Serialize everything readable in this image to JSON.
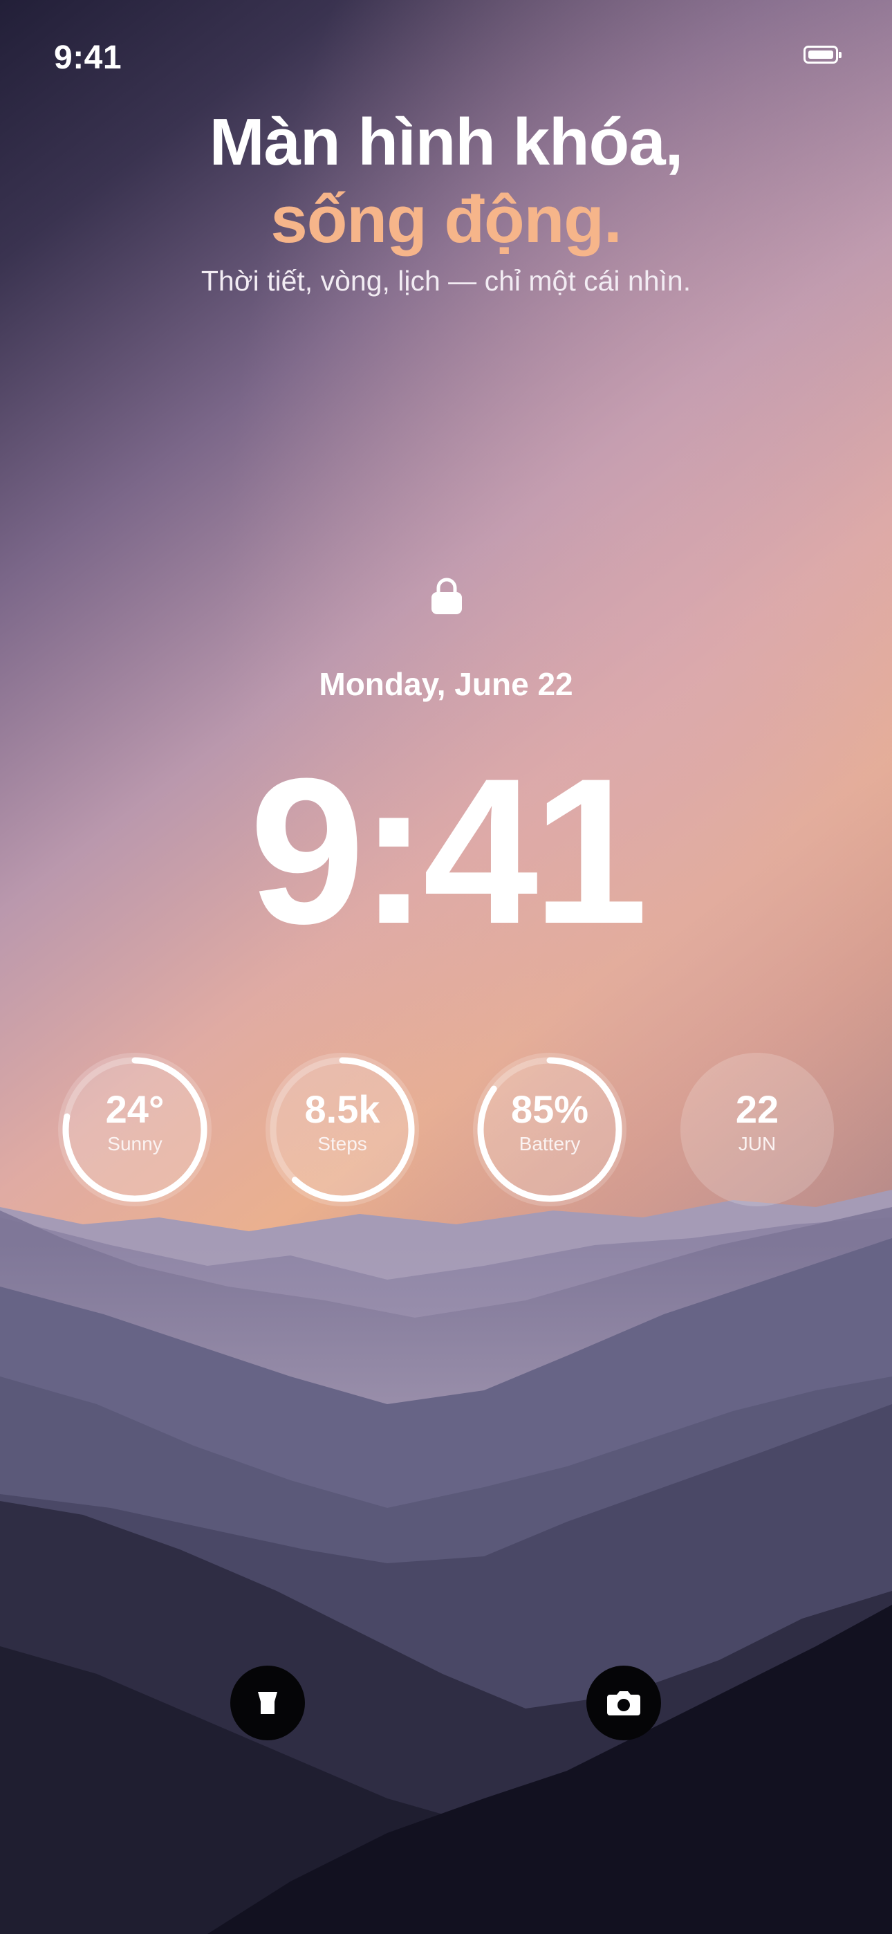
{
  "status_bar": {
    "time": "9:41",
    "battery_icon": "battery-icon"
  },
  "headline": {
    "line1": "Màn hình khóa,",
    "line2": "sống động.",
    "subtitle": "Thời tiết, vòng, lịch — chỉ một cái nhìn.",
    "accent_color": "#f6b58a"
  },
  "lock_screen": {
    "lock_icon": "lock-icon",
    "date": "Monday, June 22",
    "time": "9:41"
  },
  "widgets": [
    {
      "value": "24°",
      "label": "Sunny",
      "ring_fill": 0.78
    },
    {
      "value": "8.5k",
      "label": "Steps",
      "ring_fill": 0.62
    },
    {
      "value": "85%",
      "label": "Battery",
      "ring_fill": 0.85
    },
    {
      "value": "22",
      "label": "JUN",
      "ring_fill": 0
    }
  ],
  "quick_actions": {
    "left_icon": "flashlight-icon",
    "right_icon": "camera-icon"
  }
}
